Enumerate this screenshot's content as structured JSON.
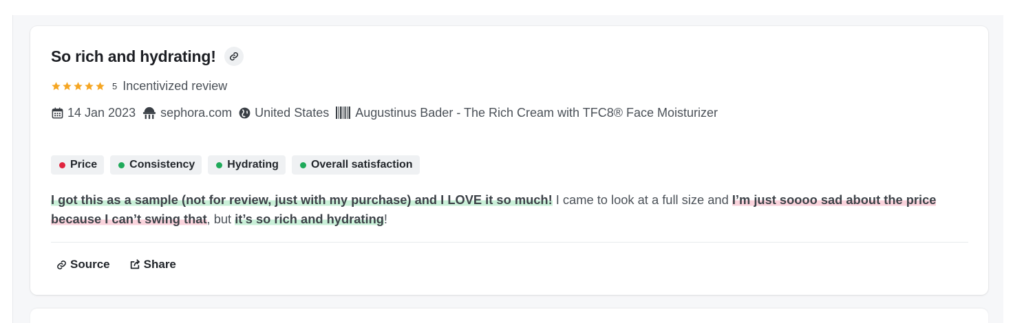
{
  "review": {
    "title": "So rich and hydrating!",
    "rating": 5,
    "rating_label": "5",
    "incentivized_label": "Incentivized review",
    "date": "14 Jan 2023",
    "source_site": "sephora.com",
    "country": "United States",
    "product": "Augustinus Bader - The Rich Cream with TFC8® Face Moisturizer"
  },
  "tags": [
    {
      "label": "Price",
      "sentiment": "negative",
      "color": "#e0243f"
    },
    {
      "label": "Consistency",
      "sentiment": "positive",
      "color": "#1faa5a"
    },
    {
      "label": "Hydrating",
      "sentiment": "positive",
      "color": "#1faa5a"
    },
    {
      "label": "Overall satisfaction",
      "sentiment": "positive",
      "color": "#1faa5a"
    }
  ],
  "body": {
    "seg1": "I got this as a sample (not for review, just with my purchase) and I LOVE it so much!",
    "seg2": " I came to look at a full size and ",
    "seg3": "I’m just soooo sad about the price because I can’t swing that",
    "seg4": ", but ",
    "seg5": "it’s so rich and hydrating",
    "seg6": "!"
  },
  "actions": {
    "source_label": "Source",
    "share_label": "Share"
  },
  "colors": {
    "star": "#f5a623",
    "positive_highlight": "#c9f0d8",
    "negative_highlight": "#fad3dc"
  },
  "icons": [
    "link-icon",
    "star-icon",
    "calendar-icon",
    "robot-icon",
    "globe-icon",
    "barcode-icon",
    "share-icon"
  ]
}
